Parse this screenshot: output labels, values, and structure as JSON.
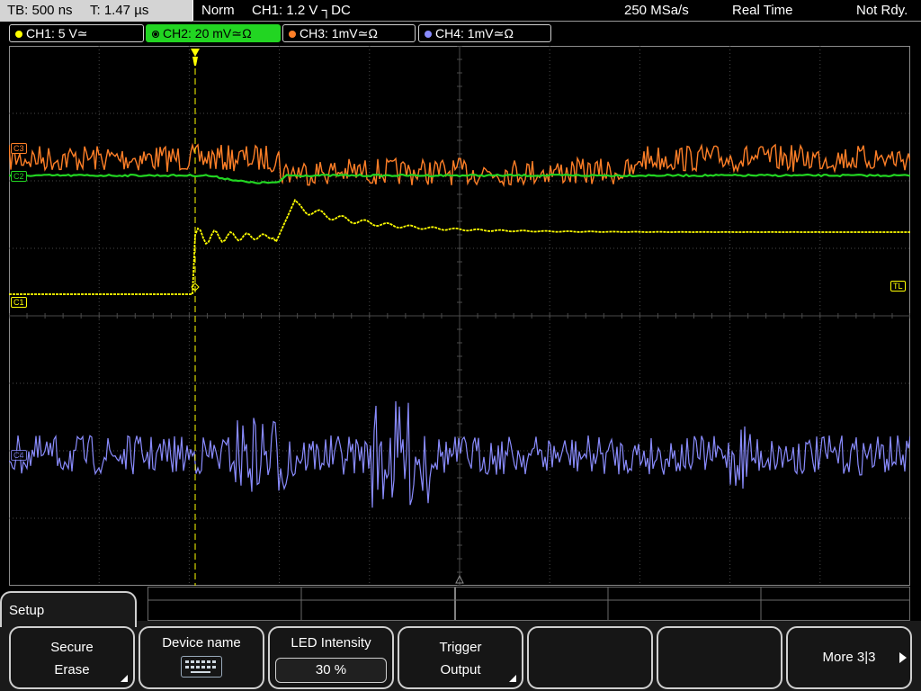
{
  "top": {
    "timebase": "TB: 500 ns",
    "trigger_time": "T: 1.47 µs",
    "mode": "Norm",
    "trigger_info": "CH1: 1.2 V ┐DC",
    "sample_rate": "250 MSa/s",
    "acq_mode": "Real Time",
    "status": "Not Rdy."
  },
  "channels": [
    {
      "label": "CH1: 5 V≃",
      "color": "#ffff00",
      "active": false
    },
    {
      "label": "CH2: 20 mV≃Ω",
      "color": "#22d522",
      "active": true
    },
    {
      "label": "CH3: 1mV≃Ω",
      "color": "#ff7f27",
      "active": false
    },
    {
      "label": "CH4: 1mV≃Ω",
      "color": "#8a8cff",
      "active": false
    }
  ],
  "markers": {
    "c3": "C3",
    "c2": "C2",
    "c1": "C1",
    "c4": "C4",
    "trigger_level": "TL"
  },
  "menu": {
    "title": "Setup",
    "softkeys": {
      "secure_erase_l1": "Secure",
      "secure_erase_l2": "Erase",
      "device_name": "Device name",
      "led_label": "LED Intensity",
      "led_value": "30 %",
      "trigger_output_l1": "Trigger",
      "trigger_output_l2": "Output",
      "more": "More 3|3"
    }
  },
  "icons": [
    "keyboard-icon",
    "trigger-marker-icon",
    "submenu-arrow-icon",
    "next-page-arrow-icon"
  ],
  "colors": {
    "ch1": "#ffff00",
    "ch2": "#22d522",
    "ch3": "#ff7f27",
    "ch4": "#8a8cff",
    "grid": "#4a4a4a"
  }
}
